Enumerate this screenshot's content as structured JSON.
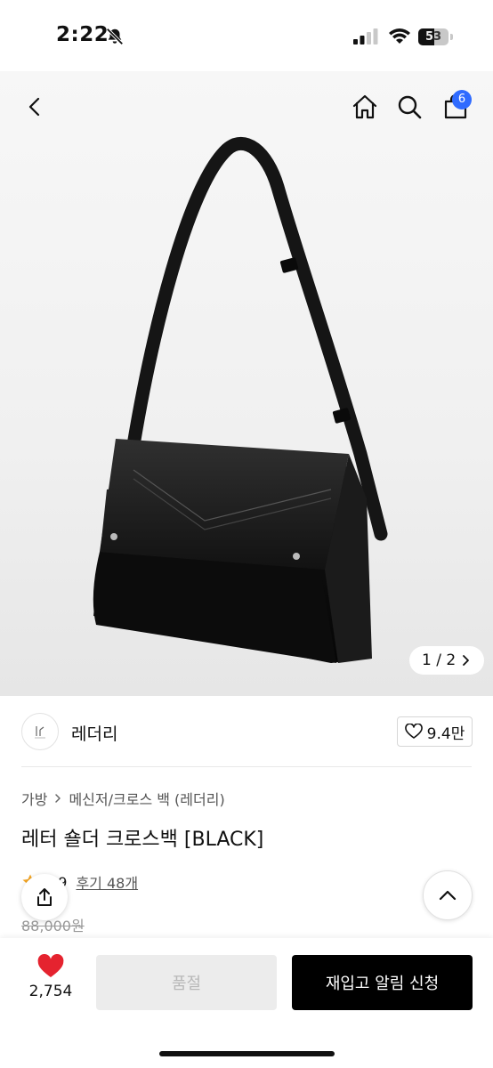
{
  "status_bar": {
    "time": "2:22",
    "battery": "53",
    "battery_level": 0.53
  },
  "icons": {
    "back": "chevron-left-icon",
    "home": "home-icon",
    "search": "search-icon",
    "cart": "shopping-bag-icon",
    "share": "share-icon",
    "scroll_top": "chevron-up-icon",
    "wish": "heart-icon",
    "like": "heart-outline-icon",
    "counter_next": "chevron-right-icon",
    "breadcrumb_sep": "chevron-right-icon"
  },
  "header": {
    "cart_badge": "6"
  },
  "gallery": {
    "counter": "1 / 2"
  },
  "brand": {
    "name": "레더리",
    "likes": "9.4만"
  },
  "product": {
    "breadcrumb": [
      "가방",
      "메신저/크로스 백 (레더리)"
    ],
    "title": "레터 숄더 크로스백 [BLACK]",
    "rating": "4.9",
    "reviews": "후기 48개",
    "original_price": "88,000원"
  },
  "bottom_bar": {
    "wish_count": "2,754",
    "soldout_label": "품절",
    "restock_label": "재입고 알림 신청"
  },
  "colors": {
    "badge": "#2f6bff",
    "wish_heart": "#e5232f",
    "primary_button": "#000000",
    "disabled_button": "#ececec"
  }
}
